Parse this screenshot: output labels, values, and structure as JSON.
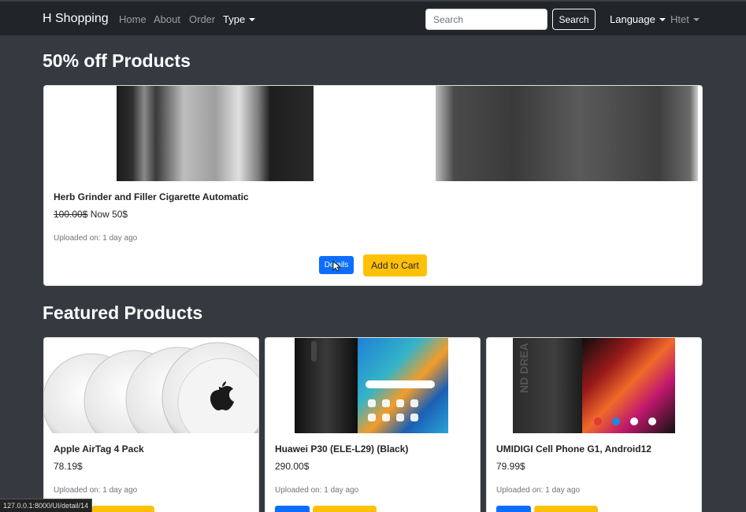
{
  "navbar": {
    "brand": "H Shopping",
    "links": [
      "Home",
      "About",
      "Order"
    ],
    "type_dropdown": "Type",
    "search_placeholder": "Search",
    "search_button": "Search",
    "language_dropdown": "Language",
    "user_dropdown": "Htet"
  },
  "sale_section": {
    "title": "50% off Products",
    "product": {
      "name": "Herb Grinder and Filler Cigarette Automatic",
      "old_price": "100.00$",
      "new_price": "Now 50$",
      "uploaded": "Uploaded on: 1 day ago",
      "details_label": "Details",
      "cart_label": "Add to Cart"
    }
  },
  "featured_section": {
    "title": "Featured Products",
    "products": [
      {
        "name": "Apple AirTag 4 Pack",
        "price": "78.19$",
        "uploaded": "Uploaded on: 1 day ago"
      },
      {
        "name": "Huawei P30 (ELE-L29) (Black)",
        "price": "290.00$",
        "uploaded": "Uploaded on: 1 day ago"
      },
      {
        "name": "UMIDIGI Cell Phone G1, Android12",
        "price": "79.99$",
        "uploaded": "Uploaded on: 1 day ago"
      }
    ]
  },
  "status_url": "127.0.0.1:8000/UI/detail/14"
}
